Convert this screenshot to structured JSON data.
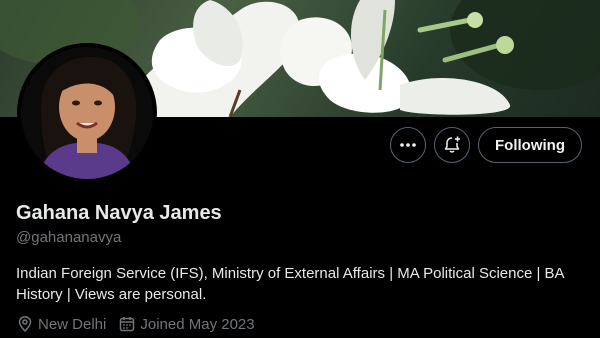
{
  "profile": {
    "name": "Gahana Navya James",
    "handle": "@gahananavya",
    "bio": "Indian Foreign Service (IFS), Ministry of External Affairs | MA Political Science | BA History | Views are personal.",
    "location": "New Delhi",
    "joined": "Joined May 2023"
  },
  "actions": {
    "following_label": "Following"
  },
  "icons": {
    "more": "more-horizontal-icon",
    "notify": "bell-plus-icon",
    "location": "location-pin-icon",
    "calendar": "calendar-icon"
  },
  "colors": {
    "background": "#000000",
    "text_primary": "#e7e9ea",
    "text_secondary": "#71767b",
    "button_border": "#536471"
  }
}
